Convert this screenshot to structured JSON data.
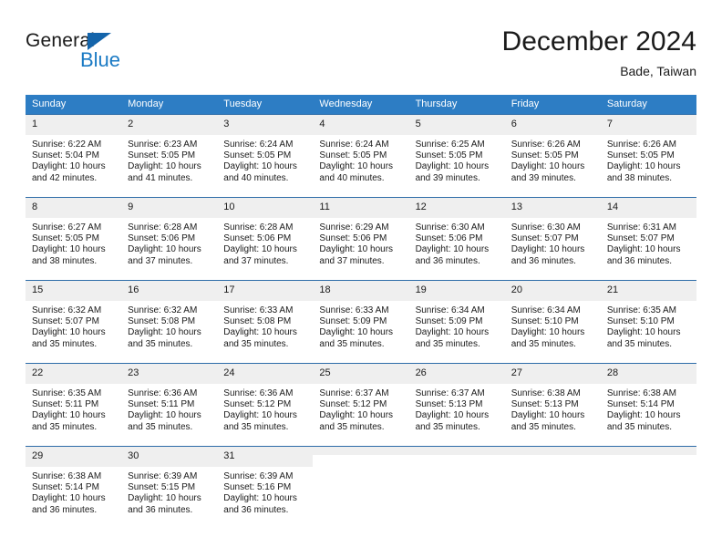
{
  "logo": {
    "word_top": "General",
    "word_bottom": "Blue",
    "triangle_icon": "blue-triangle-icon",
    "accent_color": "#1a7ac4"
  },
  "header": {
    "title": "December 2024",
    "location": "Bade, Taiwan"
  },
  "calendar": {
    "header_bg": "#2d7dc4",
    "daynum_bg": "#efefef",
    "row_border": "#2d6ca8",
    "weekdays": [
      "Sunday",
      "Monday",
      "Tuesday",
      "Wednesday",
      "Thursday",
      "Friday",
      "Saturday"
    ],
    "weeks": [
      [
        {
          "day": "1",
          "sunrise": "Sunrise: 6:22 AM",
          "sunset": "Sunset: 5:04 PM",
          "daylight": "Daylight: 10 hours and 42 minutes."
        },
        {
          "day": "2",
          "sunrise": "Sunrise: 6:23 AM",
          "sunset": "Sunset: 5:05 PM",
          "daylight": "Daylight: 10 hours and 41 minutes."
        },
        {
          "day": "3",
          "sunrise": "Sunrise: 6:24 AM",
          "sunset": "Sunset: 5:05 PM",
          "daylight": "Daylight: 10 hours and 40 minutes."
        },
        {
          "day": "4",
          "sunrise": "Sunrise: 6:24 AM",
          "sunset": "Sunset: 5:05 PM",
          "daylight": "Daylight: 10 hours and 40 minutes."
        },
        {
          "day": "5",
          "sunrise": "Sunrise: 6:25 AM",
          "sunset": "Sunset: 5:05 PM",
          "daylight": "Daylight: 10 hours and 39 minutes."
        },
        {
          "day": "6",
          "sunrise": "Sunrise: 6:26 AM",
          "sunset": "Sunset: 5:05 PM",
          "daylight": "Daylight: 10 hours and 39 minutes."
        },
        {
          "day": "7",
          "sunrise": "Sunrise: 6:26 AM",
          "sunset": "Sunset: 5:05 PM",
          "daylight": "Daylight: 10 hours and 38 minutes."
        }
      ],
      [
        {
          "day": "8",
          "sunrise": "Sunrise: 6:27 AM",
          "sunset": "Sunset: 5:05 PM",
          "daylight": "Daylight: 10 hours and 38 minutes."
        },
        {
          "day": "9",
          "sunrise": "Sunrise: 6:28 AM",
          "sunset": "Sunset: 5:06 PM",
          "daylight": "Daylight: 10 hours and 37 minutes."
        },
        {
          "day": "10",
          "sunrise": "Sunrise: 6:28 AM",
          "sunset": "Sunset: 5:06 PM",
          "daylight": "Daylight: 10 hours and 37 minutes."
        },
        {
          "day": "11",
          "sunrise": "Sunrise: 6:29 AM",
          "sunset": "Sunset: 5:06 PM",
          "daylight": "Daylight: 10 hours and 37 minutes."
        },
        {
          "day": "12",
          "sunrise": "Sunrise: 6:30 AM",
          "sunset": "Sunset: 5:06 PM",
          "daylight": "Daylight: 10 hours and 36 minutes."
        },
        {
          "day": "13",
          "sunrise": "Sunrise: 6:30 AM",
          "sunset": "Sunset: 5:07 PM",
          "daylight": "Daylight: 10 hours and 36 minutes."
        },
        {
          "day": "14",
          "sunrise": "Sunrise: 6:31 AM",
          "sunset": "Sunset: 5:07 PM",
          "daylight": "Daylight: 10 hours and 36 minutes."
        }
      ],
      [
        {
          "day": "15",
          "sunrise": "Sunrise: 6:32 AM",
          "sunset": "Sunset: 5:07 PM",
          "daylight": "Daylight: 10 hours and 35 minutes."
        },
        {
          "day": "16",
          "sunrise": "Sunrise: 6:32 AM",
          "sunset": "Sunset: 5:08 PM",
          "daylight": "Daylight: 10 hours and 35 minutes."
        },
        {
          "day": "17",
          "sunrise": "Sunrise: 6:33 AM",
          "sunset": "Sunset: 5:08 PM",
          "daylight": "Daylight: 10 hours and 35 minutes."
        },
        {
          "day": "18",
          "sunrise": "Sunrise: 6:33 AM",
          "sunset": "Sunset: 5:09 PM",
          "daylight": "Daylight: 10 hours and 35 minutes."
        },
        {
          "day": "19",
          "sunrise": "Sunrise: 6:34 AM",
          "sunset": "Sunset: 5:09 PM",
          "daylight": "Daylight: 10 hours and 35 minutes."
        },
        {
          "day": "20",
          "sunrise": "Sunrise: 6:34 AM",
          "sunset": "Sunset: 5:10 PM",
          "daylight": "Daylight: 10 hours and 35 minutes."
        },
        {
          "day": "21",
          "sunrise": "Sunrise: 6:35 AM",
          "sunset": "Sunset: 5:10 PM",
          "daylight": "Daylight: 10 hours and 35 minutes."
        }
      ],
      [
        {
          "day": "22",
          "sunrise": "Sunrise: 6:35 AM",
          "sunset": "Sunset: 5:11 PM",
          "daylight": "Daylight: 10 hours and 35 minutes."
        },
        {
          "day": "23",
          "sunrise": "Sunrise: 6:36 AM",
          "sunset": "Sunset: 5:11 PM",
          "daylight": "Daylight: 10 hours and 35 minutes."
        },
        {
          "day": "24",
          "sunrise": "Sunrise: 6:36 AM",
          "sunset": "Sunset: 5:12 PM",
          "daylight": "Daylight: 10 hours and 35 minutes."
        },
        {
          "day": "25",
          "sunrise": "Sunrise: 6:37 AM",
          "sunset": "Sunset: 5:12 PM",
          "daylight": "Daylight: 10 hours and 35 minutes."
        },
        {
          "day": "26",
          "sunrise": "Sunrise: 6:37 AM",
          "sunset": "Sunset: 5:13 PM",
          "daylight": "Daylight: 10 hours and 35 minutes."
        },
        {
          "day": "27",
          "sunrise": "Sunrise: 6:38 AM",
          "sunset": "Sunset: 5:13 PM",
          "daylight": "Daylight: 10 hours and 35 minutes."
        },
        {
          "day": "28",
          "sunrise": "Sunrise: 6:38 AM",
          "sunset": "Sunset: 5:14 PM",
          "daylight": "Daylight: 10 hours and 35 minutes."
        }
      ],
      [
        {
          "day": "29",
          "sunrise": "Sunrise: 6:38 AM",
          "sunset": "Sunset: 5:14 PM",
          "daylight": "Daylight: 10 hours and 36 minutes."
        },
        {
          "day": "30",
          "sunrise": "Sunrise: 6:39 AM",
          "sunset": "Sunset: 5:15 PM",
          "daylight": "Daylight: 10 hours and 36 minutes."
        },
        {
          "day": "31",
          "sunrise": "Sunrise: 6:39 AM",
          "sunset": "Sunset: 5:16 PM",
          "daylight": "Daylight: 10 hours and 36 minutes."
        },
        {
          "day": "",
          "sunrise": "",
          "sunset": "",
          "daylight": ""
        },
        {
          "day": "",
          "sunrise": "",
          "sunset": "",
          "daylight": ""
        },
        {
          "day": "",
          "sunrise": "",
          "sunset": "",
          "daylight": ""
        },
        {
          "day": "",
          "sunrise": "",
          "sunset": "",
          "daylight": ""
        }
      ]
    ]
  }
}
